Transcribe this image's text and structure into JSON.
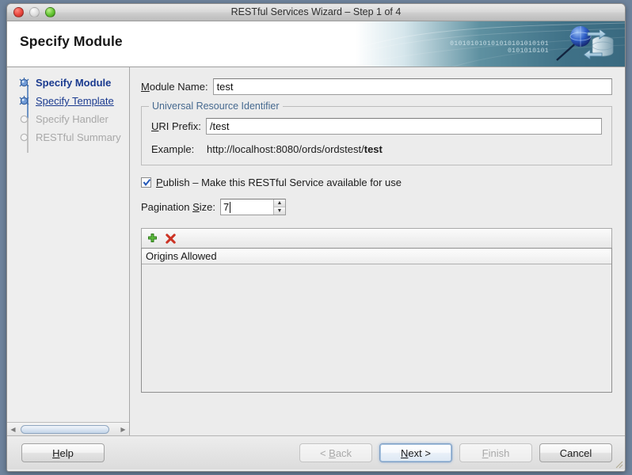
{
  "window": {
    "title": "RESTful Services Wizard – Step 1 of 4",
    "traffic_lights": [
      "close",
      "minimize",
      "zoom"
    ]
  },
  "banner": {
    "heading": "Specify Module",
    "binary_line1": "010101010101010101010101",
    "binary_line2": "0101010101"
  },
  "sidebar": {
    "steps": [
      {
        "label": "Specify Module",
        "state": "done"
      },
      {
        "label": "Specify Template",
        "state": "active"
      },
      {
        "label": "Specify  Handler",
        "state": "todo"
      },
      {
        "label": "RESTful Summary",
        "state": "todo"
      }
    ]
  },
  "form": {
    "module_name_label": "Module Name:",
    "module_name_value": "test",
    "uri_group_legend": "Universal Resource Identifier",
    "uri_prefix_label": "URI Prefix:",
    "uri_prefix_value": "/test",
    "example_label": "Example:",
    "example_url_prefix": "http://localhost:8080/ords/ordstest/",
    "example_url_bold": "test",
    "publish_label": "Publish – Make this RESTful Service available for use",
    "publish_checked": true,
    "pagination_label": "Pagination Size:",
    "pagination_value": "7"
  },
  "origins": {
    "add_icon": "plus-icon",
    "remove_icon": "delete-icon",
    "column_header": "Origins Allowed",
    "rows": []
  },
  "footer": {
    "help": "Help",
    "back": "< Back",
    "next": "Next >",
    "finish": "Finish",
    "cancel": "Cancel"
  },
  "colors": {
    "accent_blue": "#1a3a8f",
    "legend_blue": "#46698f",
    "banner_teal": "#3f7187",
    "add_green": "#3c9a28",
    "remove_red": "#cc3324",
    "desktop": "#6e839c"
  }
}
